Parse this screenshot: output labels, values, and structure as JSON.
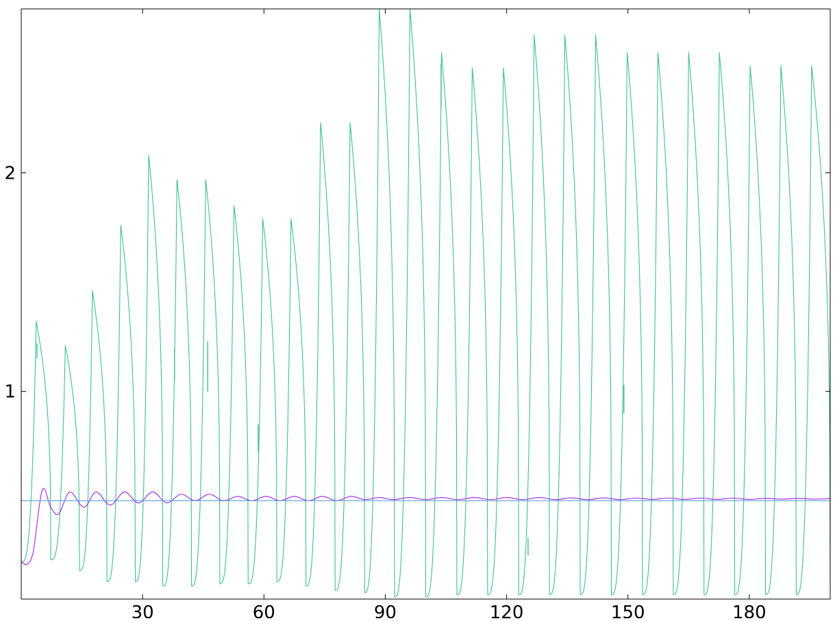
{
  "chart_data": {
    "type": "line",
    "title": "",
    "xlabel": "",
    "ylabel": "",
    "xlim": [
      0,
      200
    ],
    "ylim": [
      0.05,
      2.75
    ],
    "x_ticks": [
      30,
      60,
      90,
      120,
      150,
      180
    ],
    "x_tick_labels": [
      "30",
      "60",
      "90",
      "120",
      "150",
      "180"
    ],
    "y_ticks": [
      1,
      2
    ],
    "y_tick_labels": [
      "1",
      "2"
    ],
    "grid": false,
    "legend": "none",
    "series": [
      {
        "color": "#3dbf8f",
        "kind": "oscillation",
        "peaks": [
          [
            3.7,
            1.32
          ],
          [
            10.9,
            1.21
          ],
          [
            17.6,
            1.46
          ],
          [
            24.6,
            1.76
          ],
          [
            31.5,
            2.08
          ],
          [
            38.5,
            1.97
          ],
          [
            45.6,
            1.97
          ],
          [
            52.6,
            1.85
          ],
          [
            59.7,
            1.79
          ],
          [
            66.7,
            1.79
          ],
          [
            74.0,
            2.23
          ],
          [
            81.3,
            2.23
          ],
          [
            88.5,
            2.75
          ],
          [
            96.1,
            2.75
          ],
          [
            103.9,
            2.55
          ],
          [
            111.5,
            2.48
          ],
          [
            119.2,
            2.48
          ],
          [
            126.8,
            2.63
          ],
          [
            134.4,
            2.63
          ],
          [
            142.0,
            2.63
          ],
          [
            149.8,
            2.55
          ],
          [
            157.4,
            2.55
          ],
          [
            165.0,
            2.55
          ],
          [
            172.6,
            2.55
          ],
          [
            180.2,
            2.49
          ],
          [
            187.8,
            2.49
          ],
          [
            195.4,
            2.49
          ]
        ],
        "troughs": [
          [
            0.0,
            0.22
          ],
          [
            7.3,
            0.23
          ],
          [
            14.4,
            0.18
          ],
          [
            21.2,
            0.13
          ],
          [
            28.2,
            0.13
          ],
          [
            35.0,
            0.11
          ],
          [
            42.1,
            0.11
          ],
          [
            49.1,
            0.12
          ],
          [
            56.1,
            0.12
          ],
          [
            63.2,
            0.13
          ],
          [
            70.4,
            0.11
          ],
          [
            77.6,
            0.09
          ],
          [
            84.9,
            0.08
          ],
          [
            92.3,
            0.06
          ],
          [
            100.0,
            0.06
          ],
          [
            107.7,
            0.07
          ],
          [
            115.3,
            0.07
          ],
          [
            123.0,
            0.07
          ],
          [
            130.6,
            0.07
          ],
          [
            138.2,
            0.07
          ],
          [
            145.9,
            0.07
          ],
          [
            153.6,
            0.07
          ],
          [
            161.2,
            0.07
          ],
          [
            168.8,
            0.07
          ],
          [
            176.4,
            0.07
          ],
          [
            184.0,
            0.07
          ],
          [
            191.6,
            0.07
          ],
          [
            200.0,
            0.07
          ]
        ],
        "spikes": [
          [
            3.9,
            1.15,
            1.22
          ],
          [
            37.9,
            1.05,
            1.2
          ],
          [
            46.1,
            1.0,
            1.23
          ],
          [
            58.6,
            0.72,
            0.85
          ],
          [
            103.8,
            2.3,
            2.5
          ],
          [
            125.3,
            0.25,
            0.33
          ],
          [
            149.0,
            0.9,
            1.03
          ]
        ]
      },
      {
        "color": "#a020f0",
        "kind": "damped",
        "y0": 0.22,
        "steady": 0.5,
        "points": [
          [
            0.0,
            0.22
          ],
          [
            1.5,
            0.21
          ],
          [
            3.0,
            0.27
          ],
          [
            5.2,
            0.55
          ],
          [
            7.3,
            0.47
          ],
          [
            9.3,
            0.44
          ],
          [
            12.0,
            0.54
          ],
          [
            15.5,
            0.47
          ],
          [
            18.5,
            0.54
          ],
          [
            22.0,
            0.48
          ],
          [
            25.5,
            0.54
          ],
          [
            29.0,
            0.49
          ],
          [
            32.5,
            0.54
          ],
          [
            36.0,
            0.49
          ],
          [
            39.5,
            0.53
          ],
          [
            43.0,
            0.5
          ],
          [
            46.5,
            0.53
          ],
          [
            50.0,
            0.5
          ],
          [
            53.5,
            0.52
          ],
          [
            57.0,
            0.5
          ],
          [
            60.5,
            0.52
          ],
          [
            64.0,
            0.5
          ],
          [
            67.5,
            0.52
          ],
          [
            71.0,
            0.5
          ],
          [
            74.5,
            0.52
          ],
          [
            78.0,
            0.5
          ],
          [
            81.5,
            0.52
          ],
          [
            85.0,
            0.505
          ],
          [
            88.5,
            0.515
          ],
          [
            92.0,
            0.505
          ],
          [
            96.0,
            0.515
          ],
          [
            100.0,
            0.505
          ],
          [
            104.0,
            0.515
          ],
          [
            108.0,
            0.505
          ],
          [
            112.0,
            0.515
          ],
          [
            116.0,
            0.505
          ],
          [
            120.0,
            0.515
          ],
          [
            124.0,
            0.505
          ],
          [
            128.0,
            0.515
          ],
          [
            132.0,
            0.505
          ],
          [
            136.0,
            0.513
          ],
          [
            140.0,
            0.505
          ],
          [
            144.0,
            0.513
          ],
          [
            148.0,
            0.505
          ],
          [
            152.0,
            0.512
          ],
          [
            156.0,
            0.506
          ],
          [
            160.0,
            0.512
          ],
          [
            164.0,
            0.506
          ],
          [
            168.0,
            0.512
          ],
          [
            172.0,
            0.506
          ],
          [
            176.0,
            0.512
          ],
          [
            180.0,
            0.506
          ],
          [
            184.0,
            0.511
          ],
          [
            188.0,
            0.507
          ],
          [
            192.0,
            0.511
          ],
          [
            196.0,
            0.507
          ],
          [
            200.0,
            0.51
          ]
        ]
      },
      {
        "color": "#5aa0e0",
        "kind": "constant",
        "value": 0.5
      }
    ]
  }
}
